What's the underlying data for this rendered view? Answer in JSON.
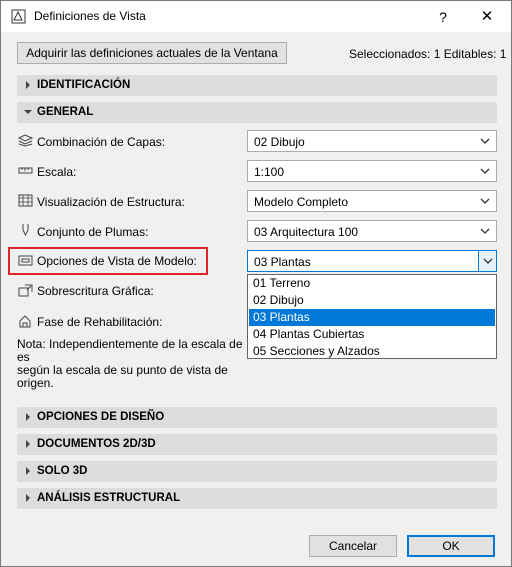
{
  "window": {
    "title": "Definiciones de Vista",
    "help_glyph": "?",
    "close_glyph": "✕"
  },
  "header": {
    "acquire_button": "Adquirir las definiciones actuales de la Ventana",
    "selection_info": "Seleccionados: 1 Editables: 1"
  },
  "sections": {
    "identificacion": "IDENTIFICACIÓN",
    "general": "GENERAL",
    "opciones_diseno": "OPCIONES DE DISEÑO",
    "documentos": "DOCUMENTOS 2D/3D",
    "solo3d": "SOLO 3D",
    "analisis": "ANÁLISIS ESTRUCTURAL"
  },
  "general": {
    "layers": {
      "label": "Combinación de Capas:",
      "value": "02 Dibujo",
      "icon": "layers-icon"
    },
    "scale": {
      "label": "Escala:",
      "value": "1:100",
      "icon": "scale-ruler-icon"
    },
    "structure": {
      "label": "Visualización de Estructura:",
      "value": "Modelo Completo",
      "icon": "structure-display-icon"
    },
    "pens": {
      "label": "Conjunto de Plumas:",
      "value": "03 Arquitectura 100",
      "icon": "pen-icon"
    },
    "model_view": {
      "label": "Opciones de Vista de Modelo:",
      "value": "03 Plantas",
      "icon": "model-view-icon"
    },
    "graphic_override": {
      "label": "Sobrescritura Gráfica:",
      "icon": "graphic-override-icon"
    },
    "renovation": {
      "label": "Fase de Rehabilitación:",
      "icon": "renovation-icon"
    }
  },
  "dropdown": {
    "options": [
      "01 Terreno",
      "02 Dibujo",
      "03 Plantas",
      "04 Plantas Cubiertas",
      "05 Secciones y Alzados"
    ],
    "selected_index": 2
  },
  "note": {
    "line1": "Nota: Independientemente de la escala de es",
    "line2": "según la escala de su punto de vista de origen."
  },
  "footer": {
    "cancel": "Cancelar",
    "ok": "OK"
  },
  "colors": {
    "accent": "#0078d7",
    "highlight": "#e0232d",
    "section_bg": "#dcdcdc"
  }
}
